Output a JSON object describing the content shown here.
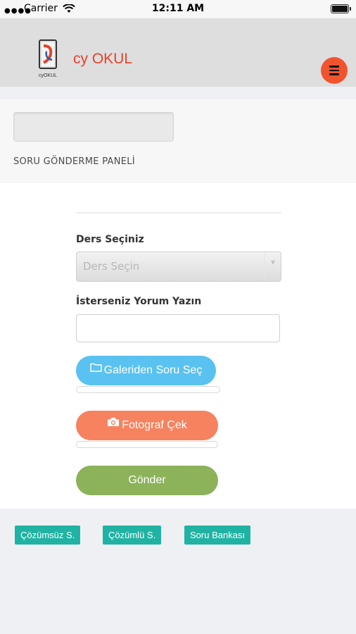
{
  "status_bar": {
    "carrier": "Carrier",
    "time": "12:11 AM"
  },
  "header": {
    "logo_text": "cyOKUL",
    "brand": "cy OKUL",
    "menu_icon": "hamburger-icon"
  },
  "panel": {
    "title": "SORU GÖNDERME PANELİ"
  },
  "form": {
    "course_label": "Ders Seçiniz",
    "course_select_value": "Ders Seçin",
    "comment_label": "İsterseniz Yorum Yazın",
    "comment_value": "",
    "gallery_button": "Galeriden Soru Seç",
    "camera_button": "Fotograf Çek",
    "send_button": "Gönder",
    "gallery_progress": 0,
    "camera_progress": 0
  },
  "tags": [
    "Çözümsüz S.",
    "Çözümlü S.",
    "Soru Bankası"
  ],
  "colors": {
    "brand": "#e8412a",
    "menu": "#f0542e",
    "gallery": "#5ac2f0",
    "camera": "#f7825f",
    "send": "#8cb25a",
    "tag": "#20b3a4"
  }
}
